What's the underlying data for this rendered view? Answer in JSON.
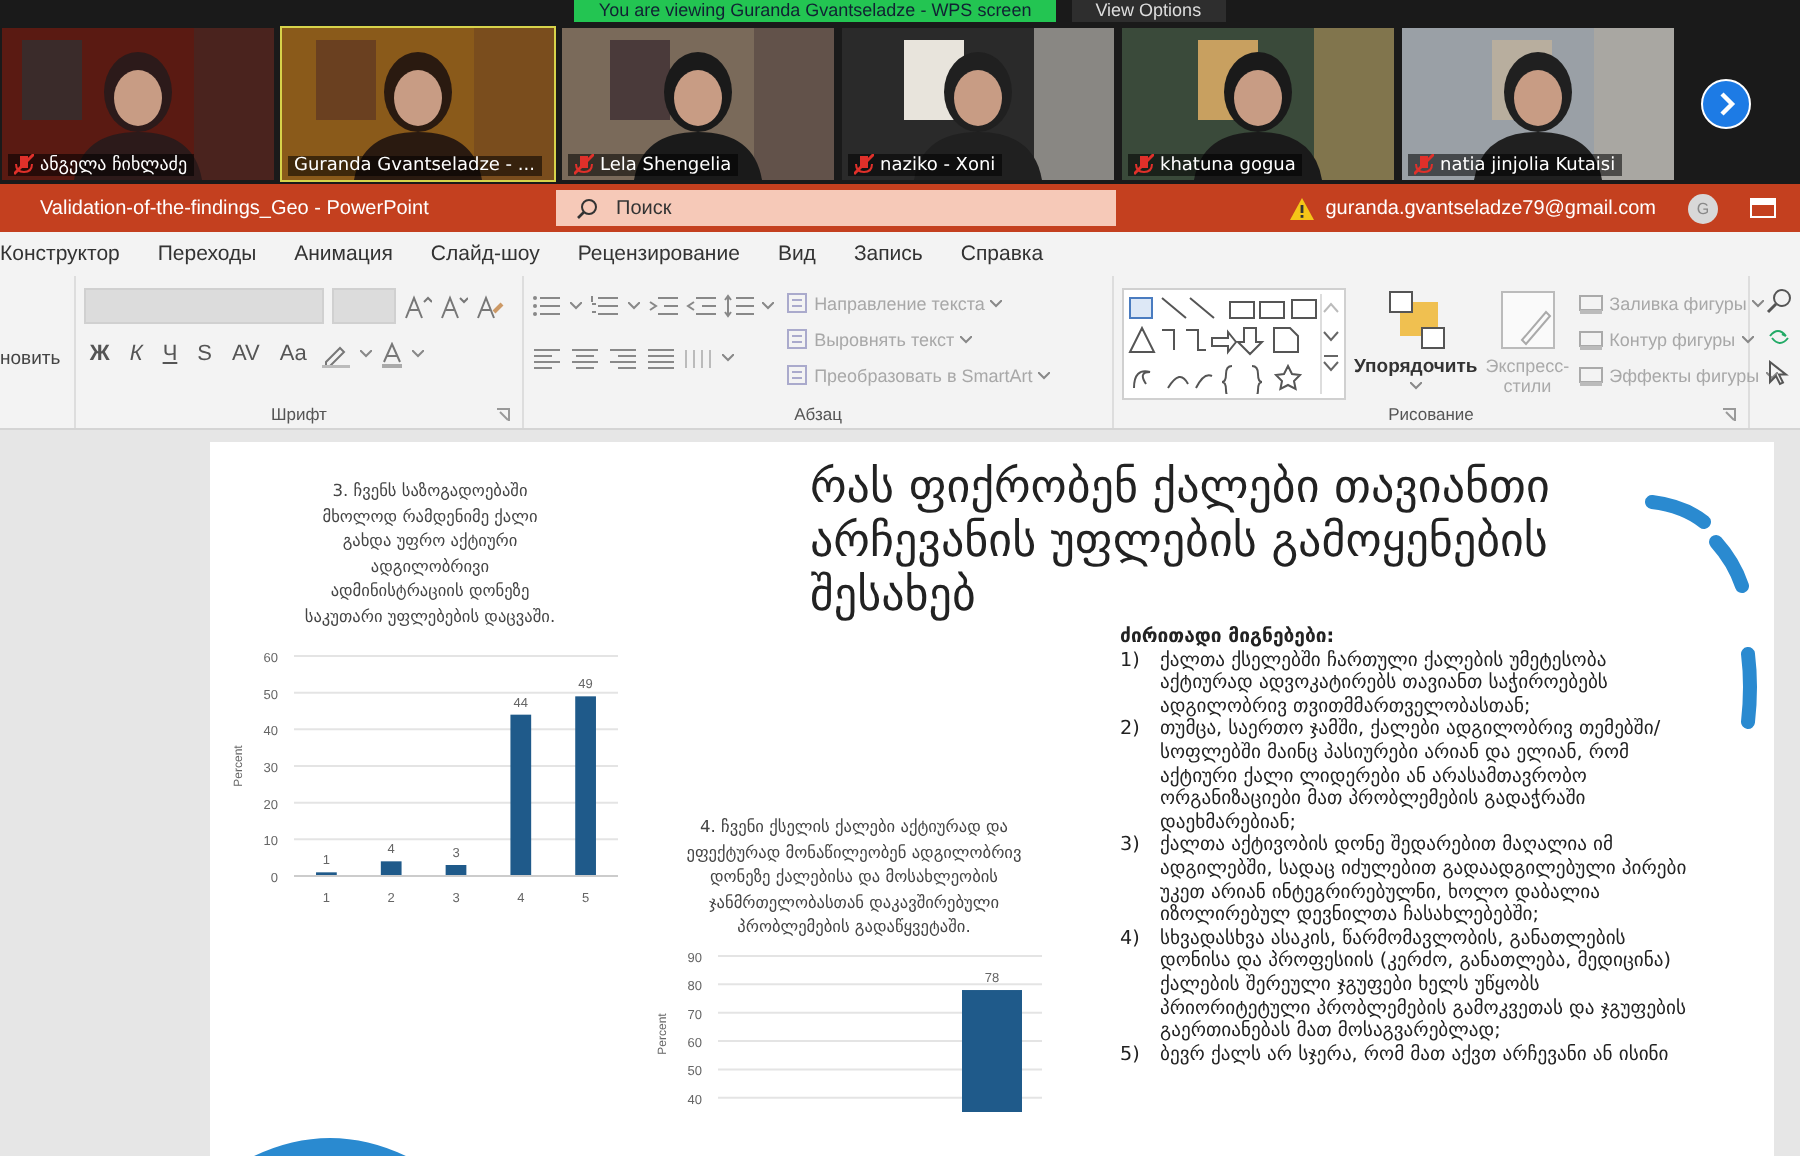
{
  "meeting": {
    "banner": "You are viewing Guranda Gvantseladze - WPS  screen",
    "view_options": "View Options",
    "participants": [
      {
        "name": "ანგელა ჩიხლაძე",
        "muted": true,
        "selected": false
      },
      {
        "name": "Guranda Gvantseladze - ...",
        "muted": false,
        "selected": true
      },
      {
        "name": "Lela Shengelia",
        "muted": true,
        "selected": false
      },
      {
        "name": "naziko - Xoni",
        "muted": true,
        "selected": false
      },
      {
        "name": "khatuna gogua",
        "muted": true,
        "selected": false
      },
      {
        "name": "natia jinjolia Kutaisi",
        "muted": true,
        "selected": false
      }
    ]
  },
  "app": {
    "title": "Validation-of-the-findings_Geo  -  PowerPoint",
    "search": {
      "placeholder": "Поиск"
    },
    "account": "guranda.gvantseladze79@gmail.com",
    "avatar": "G"
  },
  "ribbon_tabs": [
    "Конструктор",
    "Переходы",
    "Анимация",
    "Слайд-шоу",
    "Рецензирование",
    "Вид",
    "Запись",
    "Справка"
  ],
  "ribbon": {
    "cut_label": "новить",
    "font_group": {
      "label": "Шрифт",
      "format_buttons": [
        "Ж",
        "К",
        "Ч",
        "S",
        "AV",
        "Aa"
      ]
    },
    "paragraph_group": {
      "label": "Абзац",
      "commands": [
        {
          "label": "Направление текста",
          "disabled": true
        },
        {
          "label": "Выровнять текст",
          "disabled": true
        },
        {
          "label": "Преобразовать в SmartArt",
          "disabled": true
        }
      ]
    },
    "drawing_group": {
      "label": "Рисование",
      "arrange": {
        "label": "Упорядочить",
        "disabled": false
      },
      "quick_styles": {
        "label": "Экспресс-стили",
        "disabled": true
      },
      "commands": [
        {
          "label": "Заливка фигуры",
          "disabled": true
        },
        {
          "label": "Контур фигуры",
          "disabled": true
        },
        {
          "label": "Эффекты фигуры",
          "disabled": true
        }
      ]
    }
  },
  "slide": {
    "title": "რას ფიქრობენ ქალები თავიანთი არჩევანის უფლების გამოყენების შესახებ",
    "findings_heading": "ძირითადი მიგნებები:",
    "findings": [
      {
        "number": "1)",
        "text": "ქალთა ქსელებში ჩართული ქალების უმეტესობა აქტიურად ადვოკატირებს თავიანთ საჭიროებებს ადგილობრივ თვითმმართველობასთან;"
      },
      {
        "number": "2)",
        "text": "თუმცა, საერთო ჯამში, ქალები ადგილობრივ თემებში/სოფლებში მაინც პასიურები არიან და ელიან, რომ აქტიური ქალი ლიდერები ან არასამთავრობო ორგანიზაციები მათ პრობლემების გადაჭრაში დაეხმარებიან;"
      },
      {
        "number": "3)",
        "text": "ქალთა აქტივობის დონე შედარებით მაღალია იმ ადგილებში, სადაც იძულებით გადაადგილებული პირები უკეთ არიან ინტეგრირებულნი, ხოლო დაბალია იზოლირებულ დევნილთა ჩასახლებებში;"
      },
      {
        "number": "4)",
        "text": "სხვადასხვა ასაკის, წარმომავლობის, განათლების დონისა და პროფესიის (კერძო, განათლება, მედიცინა) ქალების შერეული ჯგუფები ხელს უწყობს პრიორიტეტული პრობლემების გამოკვეთას და ჯგუფების გაერთიანებას მათ მოსაგვარებლად;"
      },
      {
        "number": "5)",
        "text": "ბევრ ქალს არ სჯერა, რომ მათ აქვთ არჩევანი ან ისინი"
      }
    ],
    "charts": [
      {
        "chart_data": {
          "type": "bar",
          "title": "3. ჩვენს საზოგადოებაში მხოლოდ რამდენიმე ქალი გახდა უფრო აქტიური ადგილობრივი ადმინისტრაციის დონეზე საკუთარი უფლებების დაცვაში.",
          "ylabel": "Percent",
          "categories": [
            "1",
            "2",
            "3",
            "4",
            "5"
          ],
          "values": [
            1,
            4,
            3,
            44,
            49
          ],
          "ylim": [
            0,
            60
          ],
          "yticks": [
            0,
            10,
            20,
            30,
            40,
            50,
            60
          ],
          "grid": true,
          "data_labels": true
        }
      },
      {
        "chart_data": {
          "type": "bar",
          "title": "4. ჩვენი ქსელის ქალები აქტიურად და ეფექტურად მონაწილეობენ ადგილობრივ დონეზე ქალებისა და მოსახლეობის ჯანმრთელობასთან დაკავშირებული პრობლემების გადაწყვეტაში.",
          "ylabel": "Percent",
          "values": [
            78
          ],
          "ylim": [
            35,
            90
          ],
          "yticks": [
            40,
            50,
            60,
            70,
            80,
            90
          ],
          "grid": true,
          "data_labels": true
        }
      }
    ]
  }
}
